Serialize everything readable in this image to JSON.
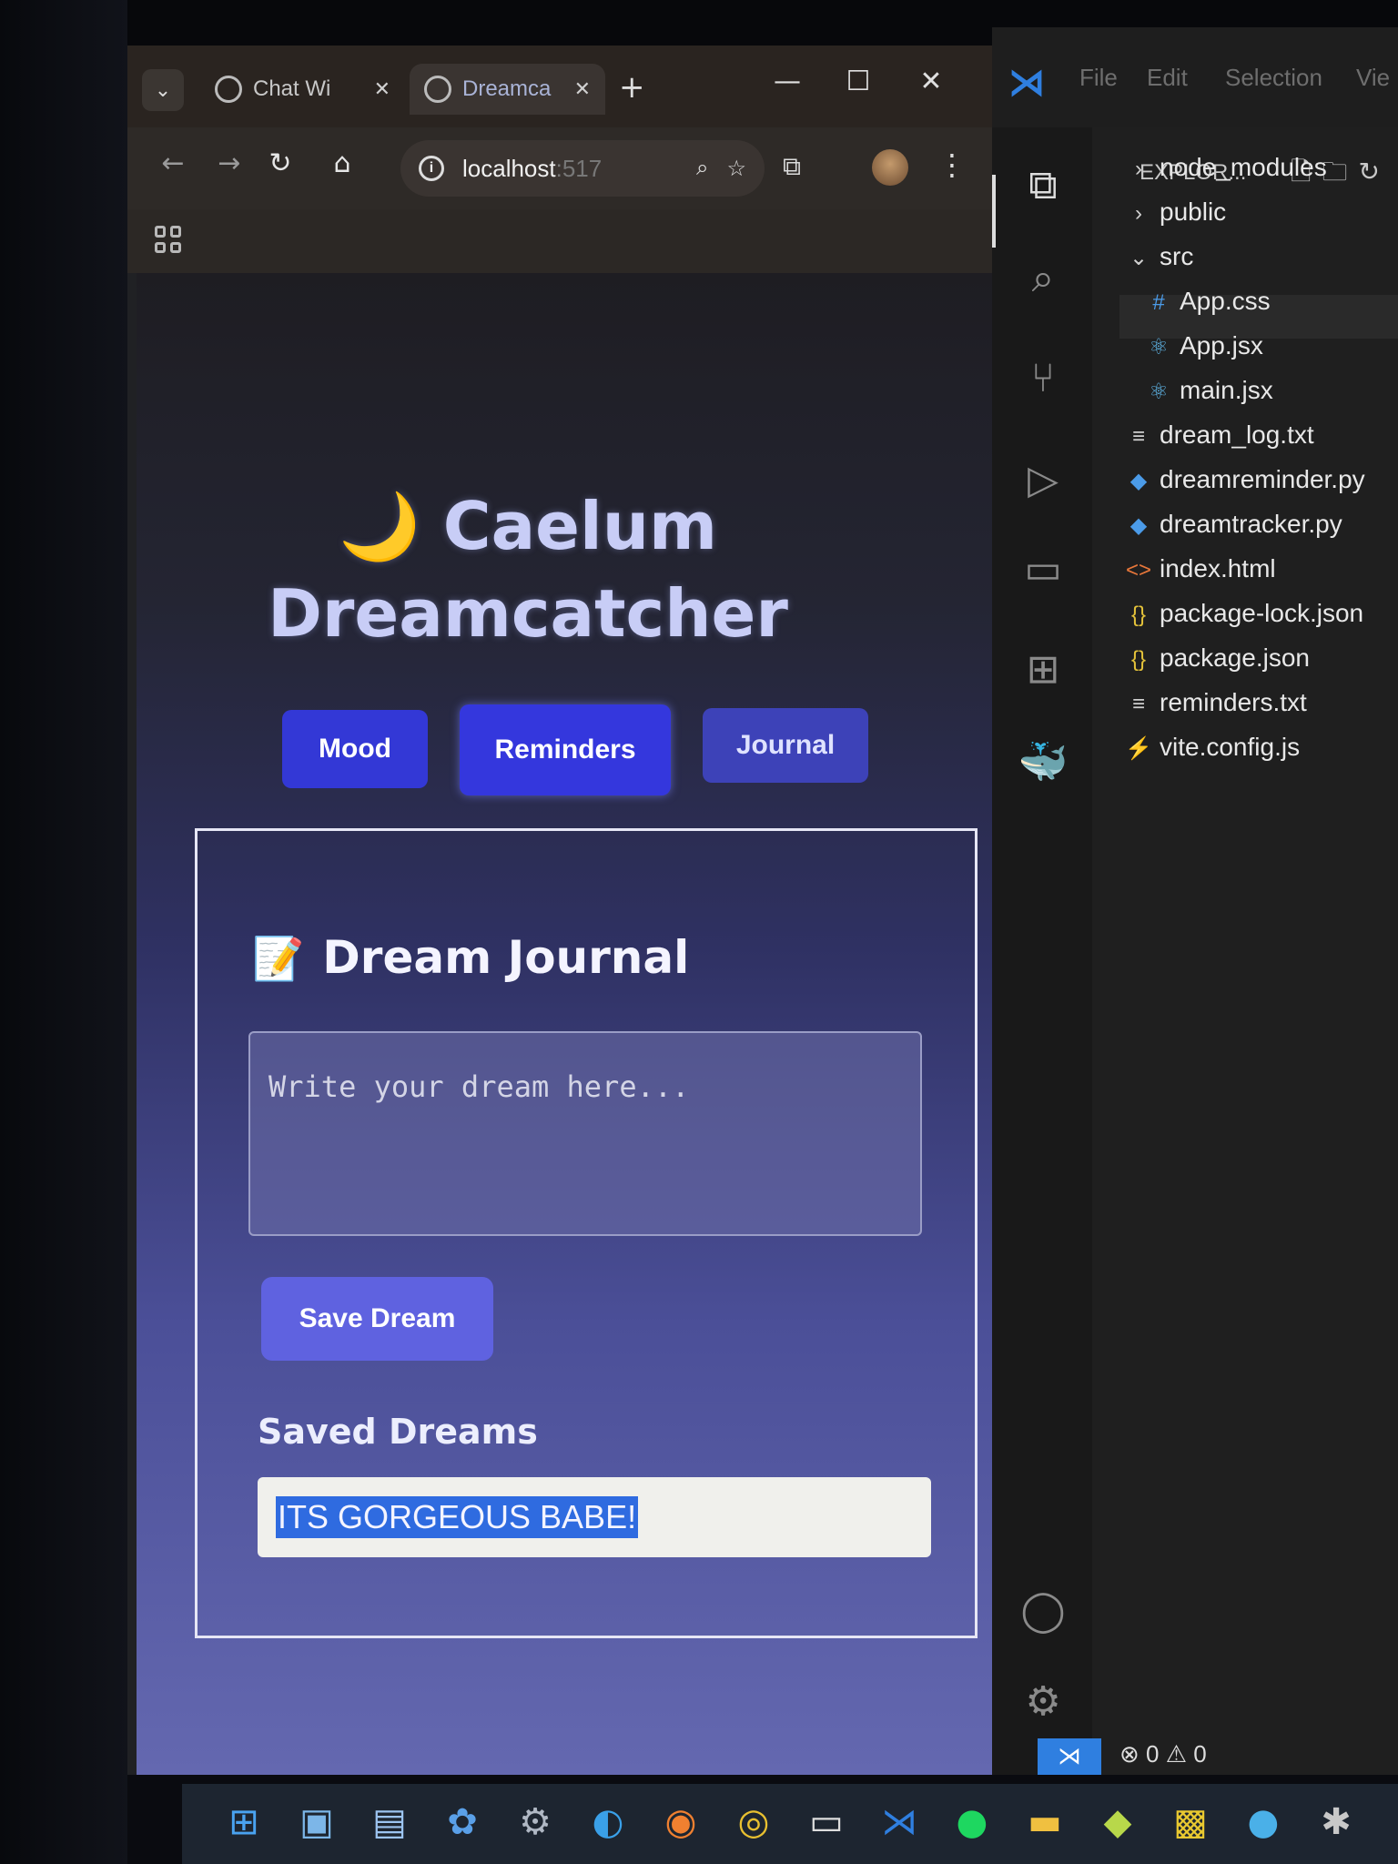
{
  "browser": {
    "tabs": [
      {
        "title": "Chat Wi",
        "close": "✕"
      },
      {
        "title": "Dreamca",
        "close": "✕"
      }
    ],
    "new_tab": "+",
    "window_controls": {
      "minimize": "—",
      "maximize": "☐",
      "close": "✕"
    },
    "address": {
      "host": "localhost",
      "rest": ":517"
    },
    "page": {
      "title_line1": "Caelum",
      "title_line2": "Dreamcatcher",
      "moon_icon": "🌙",
      "nav": {
        "mood": "Mood",
        "reminders": "Reminders",
        "journal": "Journal"
      },
      "journal": {
        "memo_icon": "📝",
        "heading": "Dream Journal",
        "input_placeholder": "Write your dream here...",
        "save_label": "Save Dream",
        "saved_heading": "Saved Dreams",
        "saved_items": [
          "ITS GORGEOUS BABE!"
        ]
      }
    }
  },
  "vscode": {
    "menu": [
      "File",
      "Edit",
      "Selection",
      "Vie"
    ],
    "explorer_title": "EXPLOR...",
    "tree": [
      {
        "name": "node_modules",
        "icon": "›",
        "kind": "folder"
      },
      {
        "name": "public",
        "icon": "›",
        "kind": "folder"
      },
      {
        "name": "src",
        "icon": "⌄",
        "kind": "folder-open"
      },
      {
        "name": "App.css",
        "icon": "#",
        "kind": "css"
      },
      {
        "name": "App.jsx",
        "icon": "⚛",
        "kind": "react"
      },
      {
        "name": "main.jsx",
        "icon": "⚛",
        "kind": "react"
      },
      {
        "name": "dream_log.txt",
        "icon": "≡",
        "kind": "txt"
      },
      {
        "name": "dreamreminder.py",
        "icon": "◆",
        "kind": "py"
      },
      {
        "name": "dreamtracker.py",
        "icon": "◆",
        "kind": "py"
      },
      {
        "name": "index.html",
        "icon": "<>",
        "kind": "html"
      },
      {
        "name": "package-lock.json",
        "icon": "{}",
        "kind": "json"
      },
      {
        "name": "package.json",
        "icon": "{}",
        "kind": "json"
      },
      {
        "name": "reminders.txt",
        "icon": "≡",
        "kind": "txt"
      },
      {
        "name": "vite.config.js",
        "icon": "⚡",
        "kind": "vite"
      }
    ],
    "status": {
      "errors": "0",
      "warnings": "0"
    }
  },
  "colors": {
    "nav_button": "#3338d6",
    "save_button": "#5f62e0",
    "title": "#c8cdf6",
    "selection": "#2f6be0"
  }
}
